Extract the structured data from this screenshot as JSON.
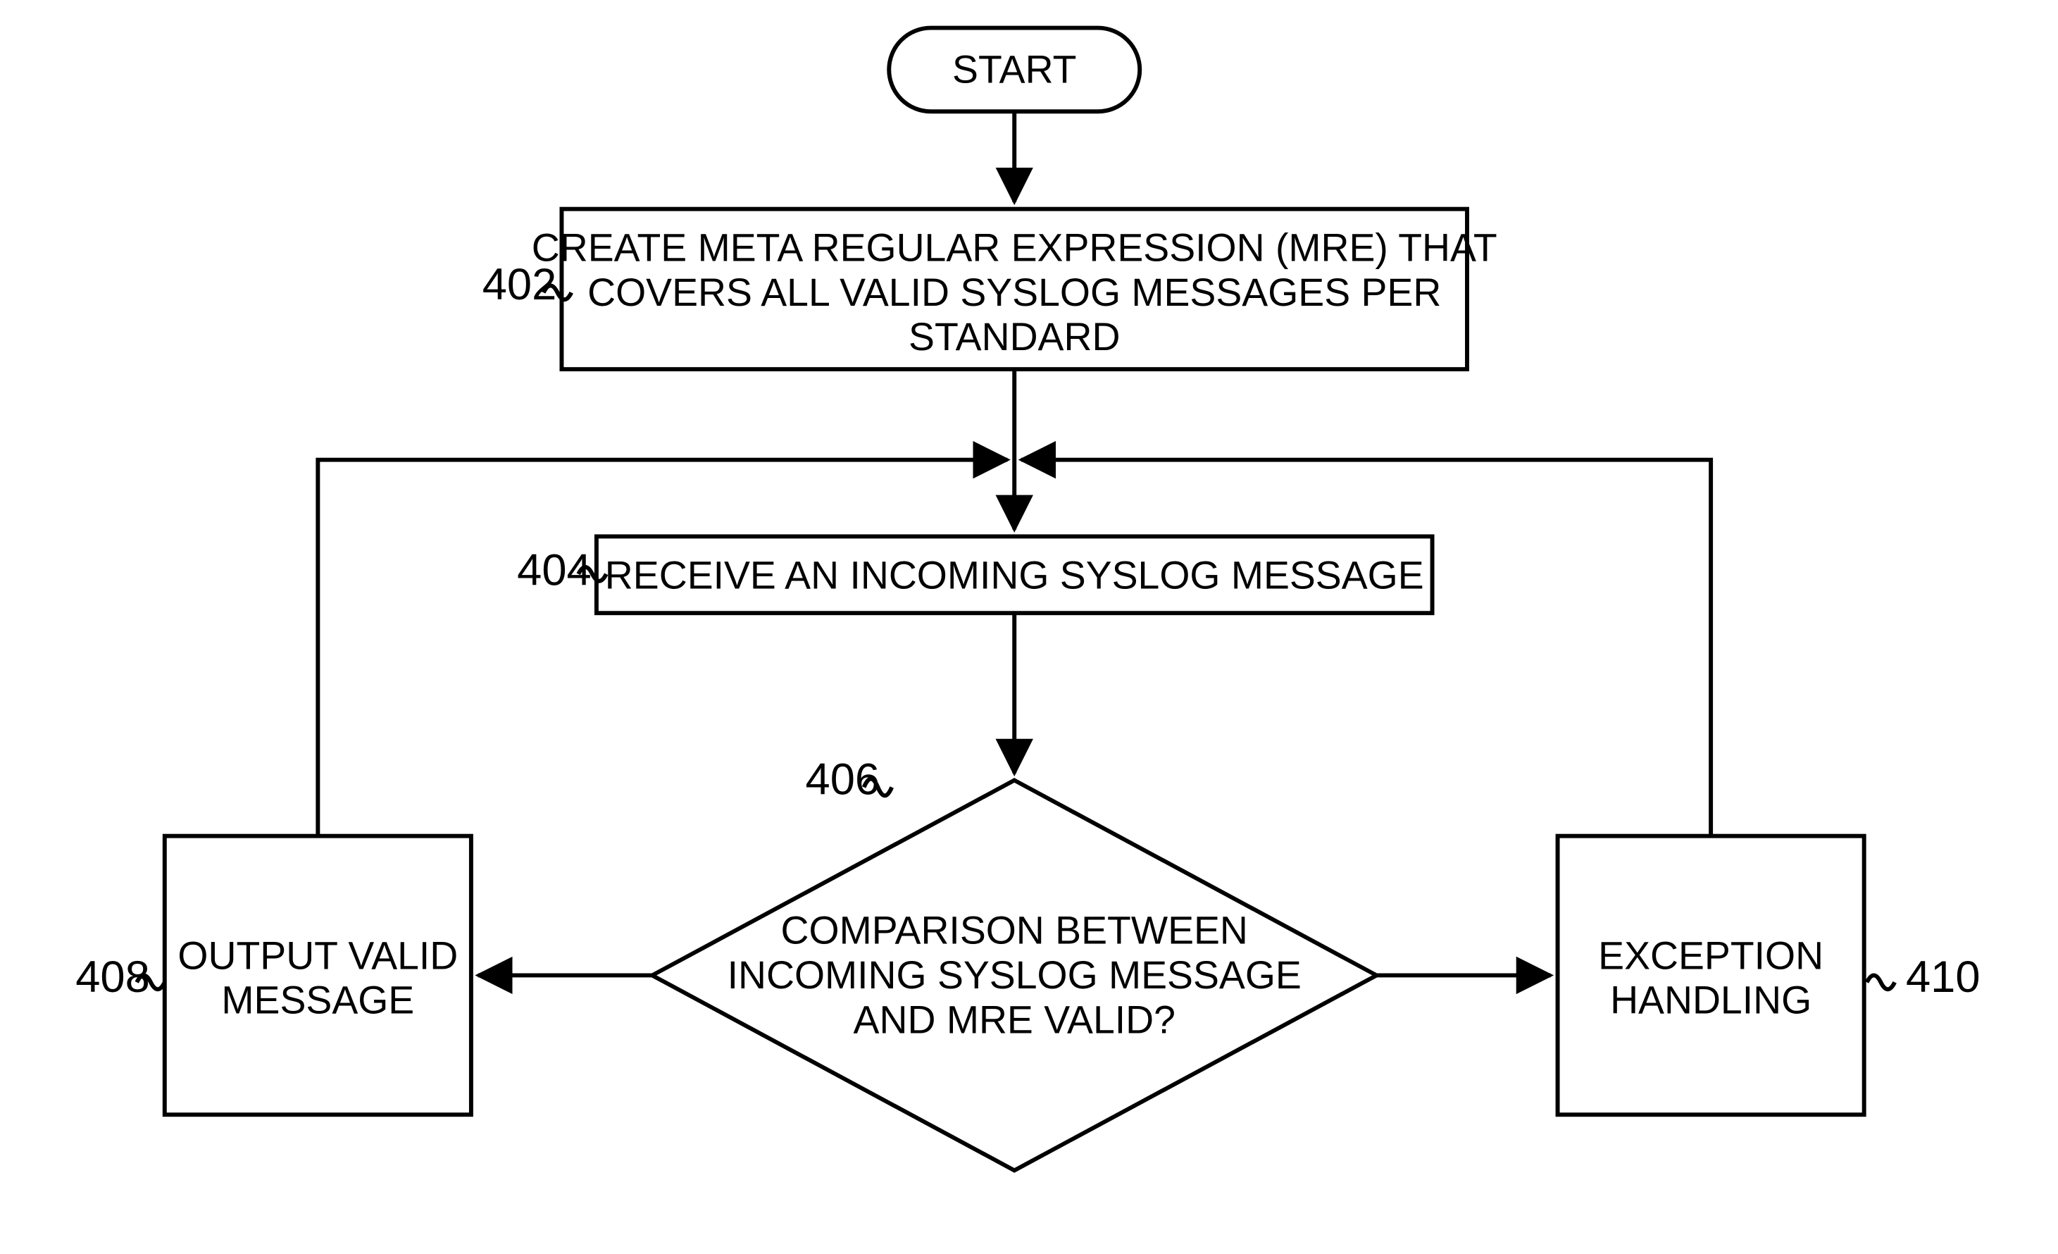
{
  "diagram": {
    "start": "START",
    "step_402": {
      "ref": "402",
      "line1": "CREATE META REGULAR EXPRESSION (MRE) THAT",
      "line2": "COVERS ALL VALID SYSLOG MESSAGES PER",
      "line3": "STANDARD"
    },
    "step_404": {
      "ref": "404",
      "text": "RECEIVE AN INCOMING SYSLOG MESSAGE"
    },
    "decision_406": {
      "ref": "406",
      "line1": "COMPARISON BETWEEN",
      "line2": "INCOMING SYSLOG MESSAGE",
      "line3": "AND MRE VALID?"
    },
    "step_408": {
      "ref": "408",
      "line1": "OUTPUT VALID",
      "line2": "MESSAGE"
    },
    "step_410": {
      "ref": "410",
      "line1": "EXCEPTION",
      "line2": "HANDLING"
    }
  }
}
